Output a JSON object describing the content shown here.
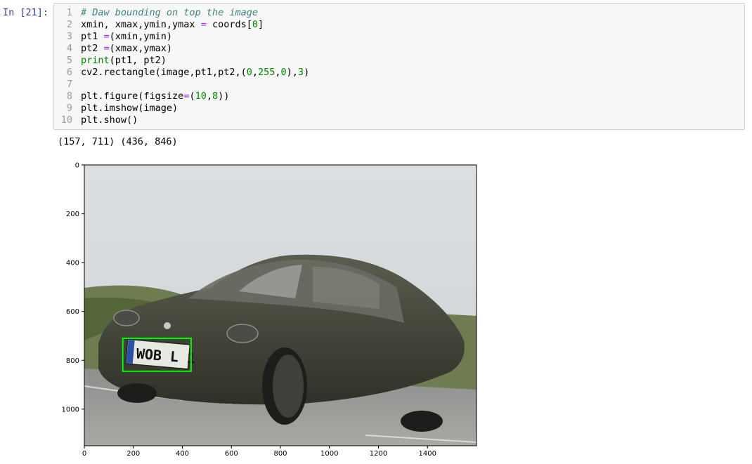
{
  "cell": {
    "prompt": "In [21]:",
    "lines": [
      {
        "n": "1",
        "segments": [
          {
            "t": "# Daw bounding on top the image",
            "c": "cm"
          }
        ]
      },
      {
        "n": "2",
        "segments": [
          {
            "t": "xmin, xmax,ymin,ymax ",
            "c": ""
          },
          {
            "t": "=",
            "c": "op"
          },
          {
            "t": " coords[",
            "c": ""
          },
          {
            "t": "0",
            "c": "num"
          },
          {
            "t": "]",
            "c": ""
          }
        ]
      },
      {
        "n": "3",
        "segments": [
          {
            "t": "pt1 ",
            "c": ""
          },
          {
            "t": "=",
            "c": "op"
          },
          {
            "t": "(xmin,ymin)",
            "c": ""
          }
        ]
      },
      {
        "n": "4",
        "segments": [
          {
            "t": "pt2 ",
            "c": ""
          },
          {
            "t": "=",
            "c": "op"
          },
          {
            "t": "(xmax,ymax)",
            "c": ""
          }
        ]
      },
      {
        "n": "5",
        "segments": [
          {
            "t": "print",
            "c": "bi"
          },
          {
            "t": "(pt1, pt2)",
            "c": ""
          }
        ]
      },
      {
        "n": "6",
        "segments": [
          {
            "t": "cv2.rectangle(image,pt1,pt2,(",
            "c": ""
          },
          {
            "t": "0",
            "c": "num"
          },
          {
            "t": ",",
            "c": ""
          },
          {
            "t": "255",
            "c": "num"
          },
          {
            "t": ",",
            "c": ""
          },
          {
            "t": "0",
            "c": "num"
          },
          {
            "t": "),",
            "c": ""
          },
          {
            "t": "3",
            "c": "num"
          },
          {
            "t": ")",
            "c": ""
          }
        ]
      },
      {
        "n": "7",
        "segments": []
      },
      {
        "n": "8",
        "segments": [
          {
            "t": "plt.figure(figsize",
            "c": ""
          },
          {
            "t": "=",
            "c": "op"
          },
          {
            "t": "(",
            "c": ""
          },
          {
            "t": "10",
            "c": "num"
          },
          {
            "t": ",",
            "c": ""
          },
          {
            "t": "8",
            "c": "num"
          },
          {
            "t": "))",
            "c": ""
          }
        ]
      },
      {
        "n": "9",
        "segments": [
          {
            "t": "plt.imshow(image)",
            "c": ""
          }
        ]
      },
      {
        "n": "10",
        "segments": [
          {
            "t": "plt.show()",
            "c": ""
          }
        ]
      }
    ]
  },
  "output": {
    "text": "(157, 711) (436, 846)"
  },
  "plot": {
    "xticks": [
      "0",
      "200",
      "400",
      "600",
      "800",
      "1000",
      "1200",
      "1400"
    ],
    "yticks": [
      "0",
      "200",
      "400",
      "600",
      "800",
      "1000"
    ],
    "plate_text": "WOB L 1"
  }
}
